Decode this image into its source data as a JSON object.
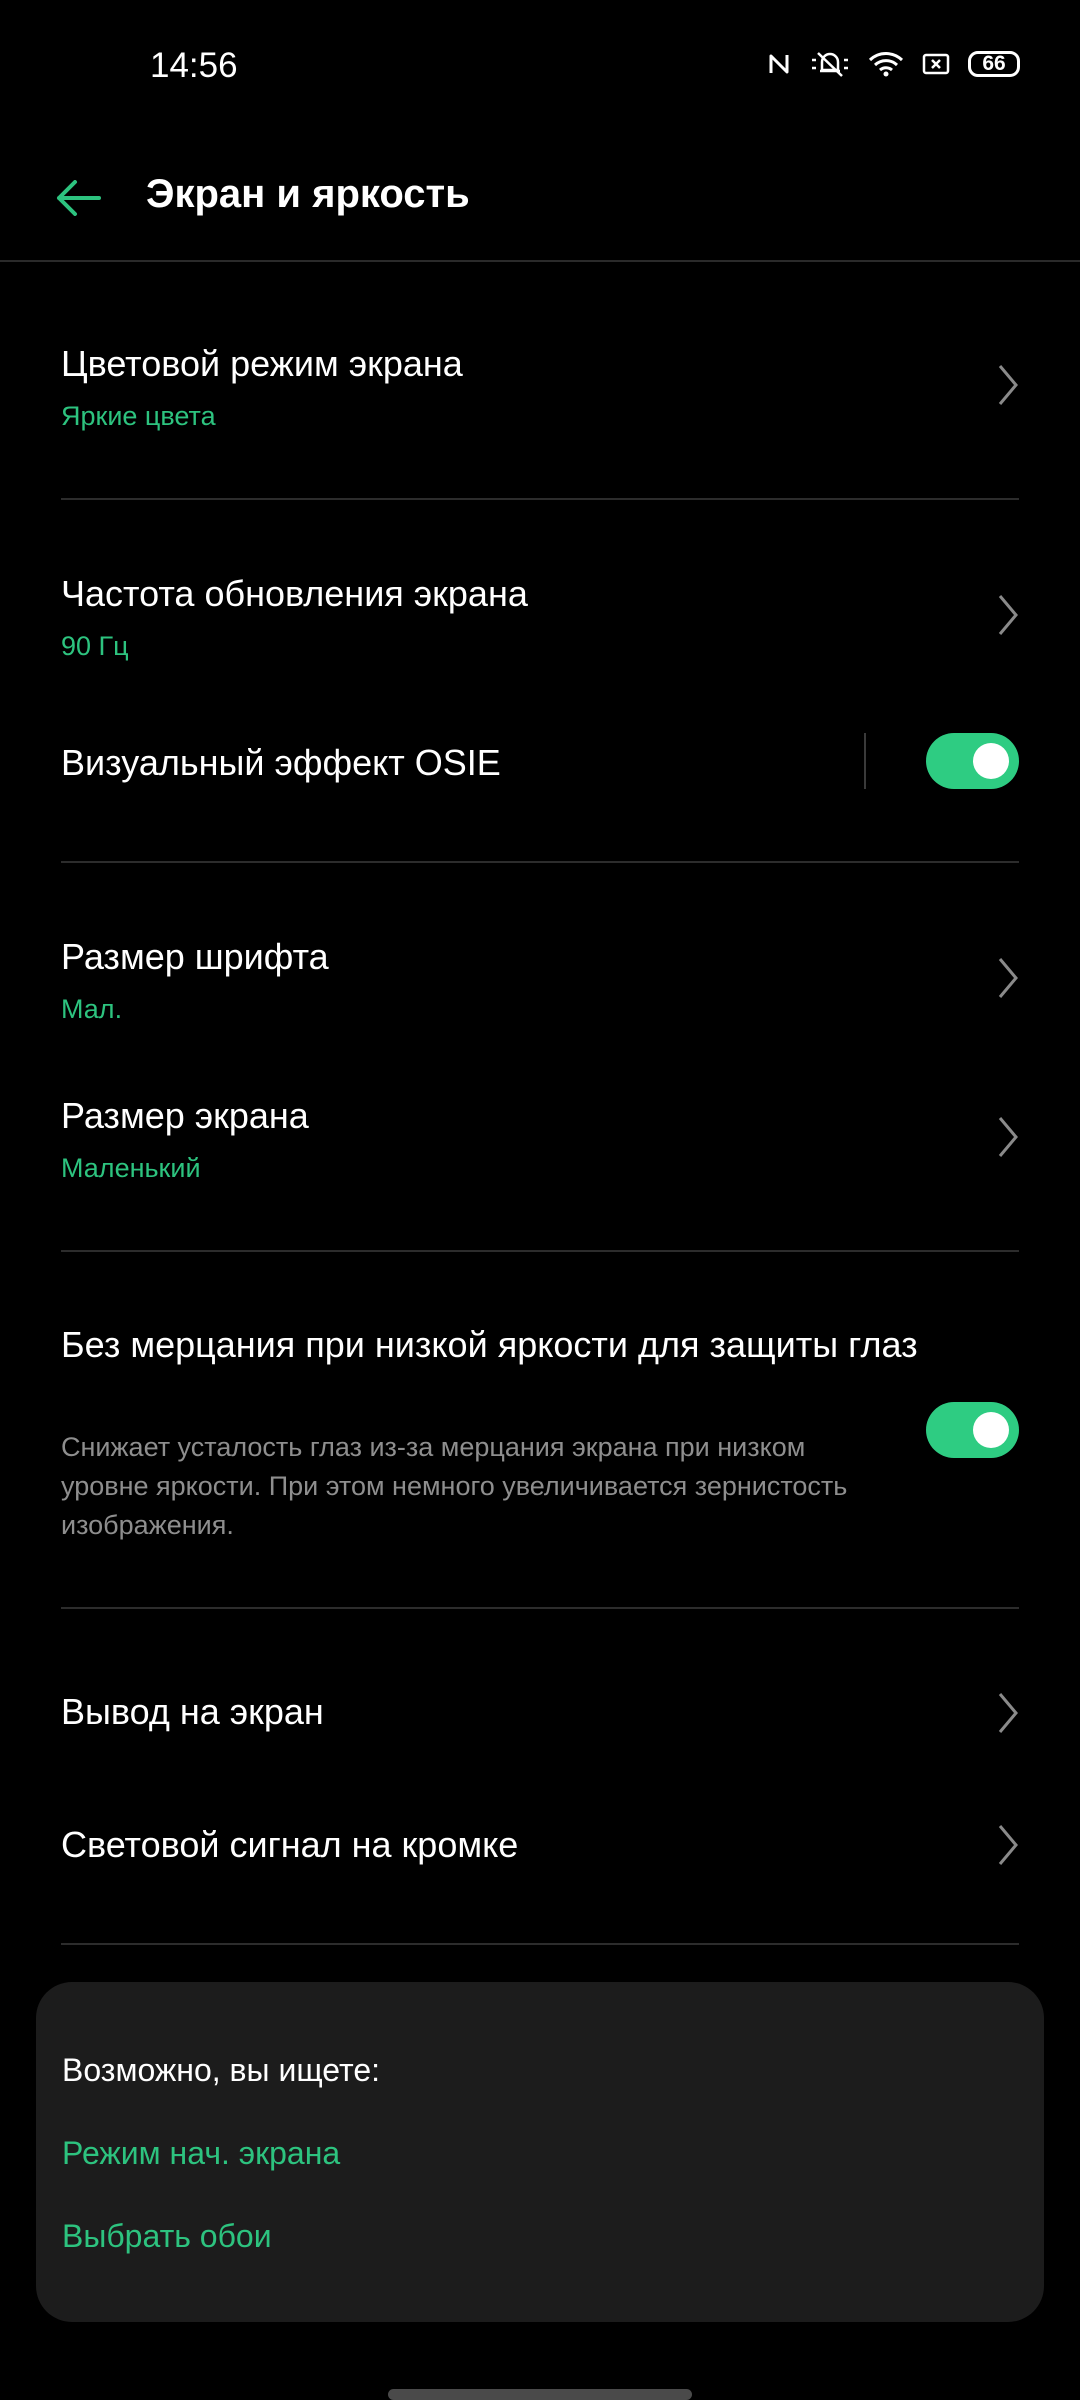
{
  "status_bar": {
    "time": "14:56",
    "battery": "66",
    "icons": [
      "nfc-icon",
      "mute-icon",
      "wifi-icon",
      "screenshot-icon",
      "battery-icon"
    ]
  },
  "header": {
    "title": "Экран и яркость",
    "back_icon": "arrow-left-icon",
    "accent_color": "#2dc37f"
  },
  "settings": {
    "color_mode": {
      "title": "Цветовой режим экрана",
      "value": "Яркие цвета"
    },
    "refresh_rate": {
      "title": "Частота обновления экрана",
      "value": "90 Гц"
    },
    "osie": {
      "title": "Визуальный эффект OSIE",
      "enabled": true
    },
    "font_size": {
      "title": "Размер шрифта",
      "value": "Мал."
    },
    "display_size": {
      "title": "Размер экрана",
      "value": "Маленький"
    },
    "flicker_free": {
      "title": "Без мерцания при низкой яркости для защиты глаз",
      "description": "Снижает усталость глаз из-за мерцания экрана при низком уровне яркости. При этом немного увеличивается зернистость изображения.",
      "enabled": true
    },
    "screen_output": {
      "title": "Вывод на экран"
    },
    "edge_light": {
      "title": "Световой сигнал на кромке"
    }
  },
  "suggestions": {
    "heading": "Возможно, вы ищете:",
    "links": [
      "Режим нач. экрана",
      "Выбрать обои"
    ]
  }
}
